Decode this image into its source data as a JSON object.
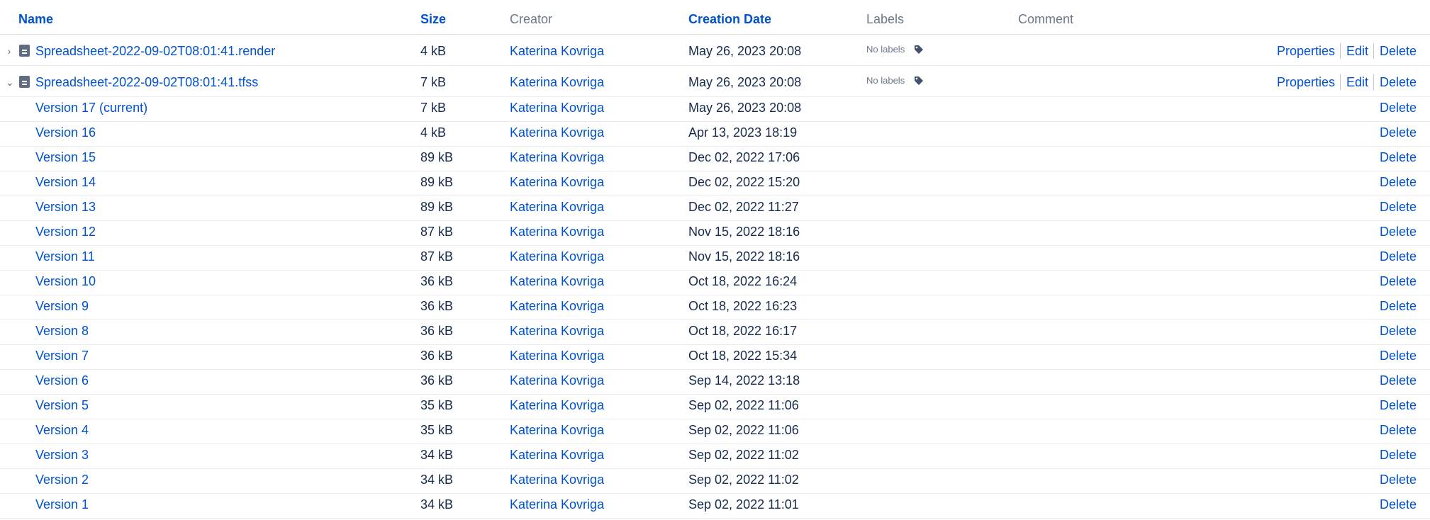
{
  "columns": {
    "name": "Name",
    "size": "Size",
    "creator": "Creator",
    "creation_date": "Creation Date",
    "labels": "Labels",
    "comment": "Comment"
  },
  "files": [
    {
      "name": "Spreadsheet-2022-09-02T08:01:41.render",
      "size": "4 kB",
      "creator": "Katerina Kovriga",
      "date": "May 26, 2023 20:08",
      "labels": "No labels",
      "expanded": false,
      "actions": {
        "properties": "Properties",
        "edit": "Edit",
        "delete": "Delete"
      }
    },
    {
      "name": "Spreadsheet-2022-09-02T08:01:41.tfss",
      "size": "7 kB",
      "creator": "Katerina Kovriga",
      "date": "May 26, 2023 20:08",
      "labels": "No labels",
      "expanded": true,
      "actions": {
        "properties": "Properties",
        "edit": "Edit",
        "delete": "Delete"
      }
    }
  ],
  "versions": [
    {
      "name": "Version 17 (current)",
      "size": "7 kB",
      "creator": "Katerina Kovriga",
      "date": "May 26, 2023 20:08",
      "delete": "Delete"
    },
    {
      "name": "Version 16",
      "size": "4 kB",
      "creator": "Katerina Kovriga",
      "date": "Apr 13, 2023 18:19",
      "delete": "Delete"
    },
    {
      "name": "Version 15",
      "size": "89 kB",
      "creator": "Katerina Kovriga",
      "date": "Dec 02, 2022 17:06",
      "delete": "Delete"
    },
    {
      "name": "Version 14",
      "size": "89 kB",
      "creator": "Katerina Kovriga",
      "date": "Dec 02, 2022 15:20",
      "delete": "Delete"
    },
    {
      "name": "Version 13",
      "size": "89 kB",
      "creator": "Katerina Kovriga",
      "date": "Dec 02, 2022 11:27",
      "delete": "Delete"
    },
    {
      "name": "Version 12",
      "size": "87 kB",
      "creator": "Katerina Kovriga",
      "date": "Nov 15, 2022 18:16",
      "delete": "Delete"
    },
    {
      "name": "Version 11",
      "size": "87 kB",
      "creator": "Katerina Kovriga",
      "date": "Nov 15, 2022 18:16",
      "delete": "Delete"
    },
    {
      "name": "Version 10",
      "size": "36 kB",
      "creator": "Katerina Kovriga",
      "date": "Oct 18, 2022 16:24",
      "delete": "Delete"
    },
    {
      "name": "Version 9",
      "size": "36 kB",
      "creator": "Katerina Kovriga",
      "date": "Oct 18, 2022 16:23",
      "delete": "Delete"
    },
    {
      "name": "Version 8",
      "size": "36 kB",
      "creator": "Katerina Kovriga",
      "date": "Oct 18, 2022 16:17",
      "delete": "Delete"
    },
    {
      "name": "Version 7",
      "size": "36 kB",
      "creator": "Katerina Kovriga",
      "date": "Oct 18, 2022 15:34",
      "delete": "Delete"
    },
    {
      "name": "Version 6",
      "size": "36 kB",
      "creator": "Katerina Kovriga",
      "date": "Sep 14, 2022 13:18",
      "delete": "Delete"
    },
    {
      "name": "Version 5",
      "size": "35 kB",
      "creator": "Katerina Kovriga",
      "date": "Sep 02, 2022 11:06",
      "delete": "Delete"
    },
    {
      "name": "Version 4",
      "size": "35 kB",
      "creator": "Katerina Kovriga",
      "date": "Sep 02, 2022 11:06",
      "delete": "Delete"
    },
    {
      "name": "Version 3",
      "size": "34 kB",
      "creator": "Katerina Kovriga",
      "date": "Sep 02, 2022 11:02",
      "delete": "Delete"
    },
    {
      "name": "Version 2",
      "size": "34 kB",
      "creator": "Katerina Kovriga",
      "date": "Sep 02, 2022 11:02",
      "delete": "Delete"
    },
    {
      "name": "Version 1",
      "size": "34 kB",
      "creator": "Katerina Kovriga",
      "date": "Sep 02, 2022 11:01",
      "delete": "Delete"
    }
  ],
  "icons": {
    "collapsed": "chevron-right-icon",
    "expanded": "chevron-down-icon",
    "file": "file-icon",
    "label": "tag-icon"
  },
  "colors": {
    "link": "#0052cc",
    "text": "#172b4d",
    "muted": "#6b778c",
    "border": "#dfe1e6"
  }
}
